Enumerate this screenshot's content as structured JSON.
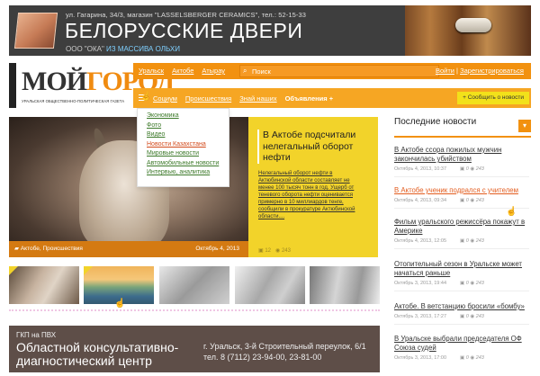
{
  "banner": {
    "address": "ул. Гагарина, 34/3, магазин \"LASSELSBERGER CERAMICS\", тел.: 52-15-33",
    "title": "БЕЛОРУССКИЕ ДВЕРИ",
    "subtitle_prefix": "ООО \"ОКА\"",
    "subtitle_accent": "ИЗ МАССИВА ОЛЬХИ"
  },
  "logo": {
    "main": "МОЙ",
    "accent": "ГОРОД",
    "tagline": "УРАЛЬСКАЯ ОБЩЕСТВЕННО-ПОЛИТИЧЕСКАЯ ГАЗЕТА"
  },
  "topbar": {
    "cities": [
      "Уральск",
      "Актобе",
      "Атырау"
    ],
    "search_placeholder": "Поиск",
    "login": "Войти",
    "register": "Зарегистрироваться"
  },
  "nav": {
    "items": [
      "Социум",
      "Происшествия",
      "Знай наших"
    ],
    "ads": "Объявления +",
    "report": "+ Сообщить о новости"
  },
  "dropdown": [
    "Экономика",
    "Фото",
    "Видео",
    "Новости Казахстана",
    "Мировые новости",
    "Автомобильные новости",
    "Интервью, аналитика"
  ],
  "hero": {
    "category": "Актобе, Происшествия",
    "date": "Октябрь 4, 2013"
  },
  "featured": {
    "title": "В Актобе подсчитали нелегальный оборот нефти",
    "text": "Нелегальный оборот нефти в Актюбинской области составляет не менее 100 тысяч тонн в год. Ущерб от теневого оборота нефти оценивается примерно в 10 миллиардов тенге, сообщили в прокуратуре Актюбинской области....",
    "comments": "12",
    "views": "243"
  },
  "ad2": {
    "small": "ГКП на ПВХ",
    "title_line1": "Областной консультативно-",
    "title_line2": "диагностический центр",
    "addr_line1": "г. Уральск, 3-й Строительный переулок, 6/1",
    "addr_line2": "тел. 8 (7112) 23-94-00, 23-81-00"
  },
  "sidebar": {
    "header": "Последние новости",
    "news": [
      {
        "title": "В Актобе ссора пожилых мужчин закончилась убийством",
        "date": "Октябрь 4, 2013, 10:37",
        "comments": "0",
        "views": "243"
      },
      {
        "title": "В Актобе ученик подрался с учителем",
        "date": "Октябрь 4, 2013, 09:34",
        "comments": "0",
        "views": "243"
      },
      {
        "title": "Фильм уральского режиссёра покажут в Америке",
        "date": "Октябрь 4, 2013, 12:05",
        "comments": "0",
        "views": "243"
      },
      {
        "title": "Отопительный сезон в Уральске может начаться раньше",
        "date": "Октябрь 3, 2013, 19:44",
        "comments": "0",
        "views": "243"
      },
      {
        "title": "Актобе. В ветстанцию бросили «бомбу»",
        "date": "Октябрь 3, 2013, 17:27",
        "comments": "0",
        "views": "243"
      },
      {
        "title": "В Уральске выбрали председателя ОФ Союза судей",
        "date": "Октябрь 3, 2013, 17:00",
        "comments": "0",
        "views": "243"
      }
    ]
  }
}
